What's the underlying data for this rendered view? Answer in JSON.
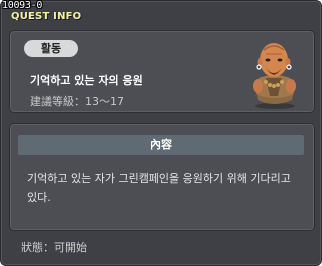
{
  "window": {
    "quest_id": "10093-0",
    "title": "QUEST INFO"
  },
  "summary": {
    "category": "활동",
    "quest_name": "기억하고 있는 자의 응원",
    "level_label": "建議等級",
    "level_range": "13～17",
    "npc_icon": "bald-monk-npc-portrait"
  },
  "details": {
    "header": "內容",
    "description": "기억하고 있는 자가 그린캠페인을 응원하기 위해 기다리고 있다."
  },
  "footer": {
    "status_label": "狀態",
    "status_value": "可開始"
  },
  "colors": {
    "window_bg": "#3f4045",
    "panel_bg": "#4d4e53",
    "title_color": "#f2f2a0",
    "header_bg": "#5f6a72"
  }
}
